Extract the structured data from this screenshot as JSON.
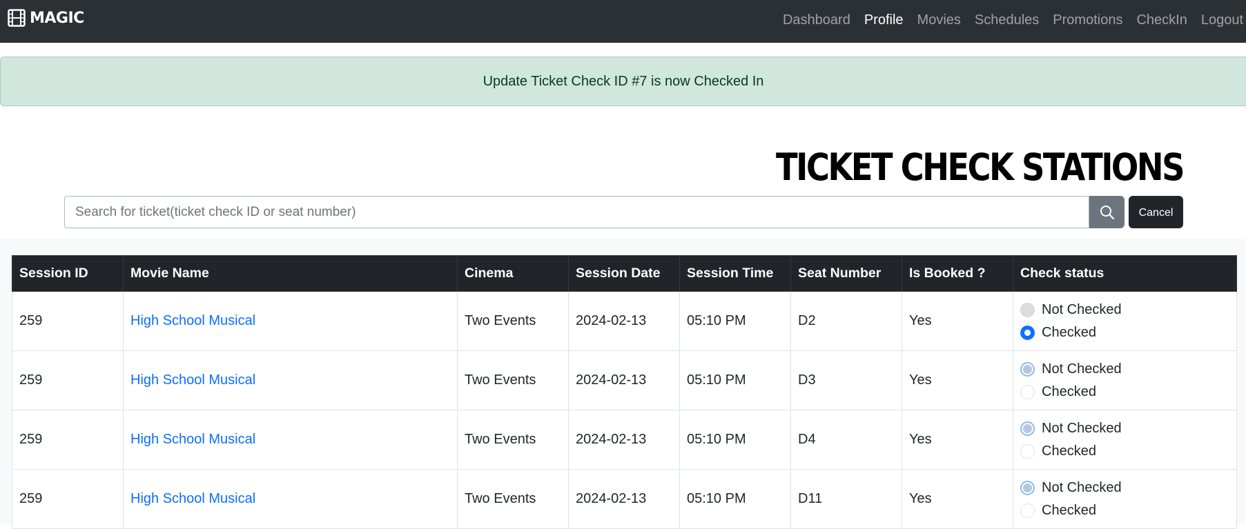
{
  "nav": {
    "brand": "MAGIC",
    "links": [
      {
        "label": "Dashboard",
        "active": false
      },
      {
        "label": "Profile",
        "active": true
      },
      {
        "label": "Movies",
        "active": false
      },
      {
        "label": "Schedules",
        "active": false
      },
      {
        "label": "Promotions",
        "active": false
      },
      {
        "label": "CheckIn",
        "active": false
      },
      {
        "label": "Logout",
        "active": false
      }
    ]
  },
  "alert": {
    "message": "Update Ticket Check ID #7 is now Checked In"
  },
  "page": {
    "title": "TICKET CHECK STATIONS"
  },
  "search": {
    "placeholder": "Search for ticket(ticket check ID or seat number)",
    "value": "",
    "cancel_label": "Cancel"
  },
  "table": {
    "headers": [
      "Session ID",
      "Movie Name",
      "Cinema",
      "Session Date",
      "Session Time",
      "Seat Number",
      "Is Booked ?",
      "Check status"
    ],
    "status_options": [
      "Not Checked",
      "Checked"
    ],
    "rows": [
      {
        "session_id": "259",
        "movie": "High School Musical",
        "cinema": "Two Events",
        "date": "2024-02-13",
        "time": "05:10 PM",
        "seat": "D2",
        "booked": "Yes",
        "status": "Checked"
      },
      {
        "session_id": "259",
        "movie": "High School Musical",
        "cinema": "Two Events",
        "date": "2024-02-13",
        "time": "05:10 PM",
        "seat": "D3",
        "booked": "Yes",
        "status": "Not Checked"
      },
      {
        "session_id": "259",
        "movie": "High School Musical",
        "cinema": "Two Events",
        "date": "2024-02-13",
        "time": "05:10 PM",
        "seat": "D4",
        "booked": "Yes",
        "status": "Not Checked"
      },
      {
        "session_id": "259",
        "movie": "High School Musical",
        "cinema": "Two Events",
        "date": "2024-02-13",
        "time": "05:10 PM",
        "seat": "D11",
        "booked": "Yes",
        "status": "Not Checked"
      }
    ]
  },
  "colors": {
    "navbar": "#2b3035",
    "alert_bg": "#d1e7dd",
    "alert_text": "#0a3622",
    "link": "#0d6efd",
    "table_header": "#212529",
    "search_button": "#6c757d",
    "cancel_button": "#212529"
  }
}
